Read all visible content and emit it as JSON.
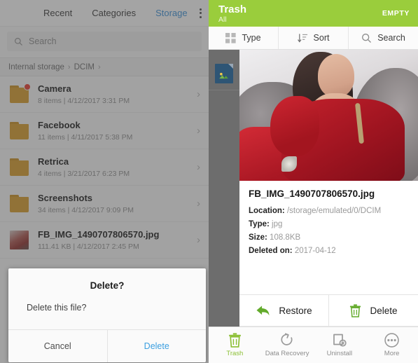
{
  "left_panel": {
    "tabs": [
      {
        "label": "Recent",
        "active": false
      },
      {
        "label": "Categories",
        "active": false
      },
      {
        "label": "Storage",
        "active": true
      }
    ],
    "overflow_icon": "more-vertical-icon",
    "search": {
      "placeholder": "Search",
      "icon": "search-icon"
    },
    "breadcrumb": {
      "root": "Internal storage",
      "folder": "DCIM"
    },
    "items": [
      {
        "name": "Camera",
        "meta": "8 items  |  4/12/2017 3:31 PM",
        "type": "folder",
        "badge": true
      },
      {
        "name": "Facebook",
        "meta": "11 items  |  4/11/2017 5:38 PM",
        "type": "folder",
        "badge": false
      },
      {
        "name": "Retrica",
        "meta": "4 items  |  3/21/2017 6:23 PM",
        "type": "folder",
        "badge": false
      },
      {
        "name": "Screenshots",
        "meta": "34 items  |  4/12/2017 9:09 PM",
        "type": "folder",
        "badge": false
      },
      {
        "name": "FB_IMG_1490707806570.jpg",
        "meta": "111.41 KB  |  4/12/2017 2:45 PM",
        "type": "image",
        "badge": false
      }
    ]
  },
  "dialog": {
    "title": "Delete?",
    "message": "Delete this file?",
    "cancel_label": "Cancel",
    "confirm_label": "Delete"
  },
  "right_panel": {
    "header": {
      "title": "Trash",
      "subtitle": "All",
      "empty_label": "EMPTY",
      "accent": "#9ACD3C"
    },
    "toolbar": [
      {
        "label": "Type",
        "icon": "grid-icon"
      },
      {
        "label": "Sort",
        "icon": "sort-icon"
      },
      {
        "label": "Search",
        "icon": "search-icon"
      }
    ],
    "file": {
      "name": "FB_IMG_1490707806570.jpg",
      "fields": [
        {
          "key": "Location:",
          "value": "/storage/emulated/0/DCIM"
        },
        {
          "key": "Type:",
          "value": "jpg"
        },
        {
          "key": "Size:",
          "value": "108.8KB"
        },
        {
          "key": "Deleted on:",
          "value": "2017-04-12"
        }
      ]
    },
    "actions": [
      {
        "label": "Restore",
        "icon": "restore-arrow-icon"
      },
      {
        "label": "Delete",
        "icon": "trash-icon"
      }
    ],
    "nav": [
      {
        "label": "Trash",
        "icon": "trash-icon",
        "active": true
      },
      {
        "label": "Data Recovery",
        "icon": "refresh-icon",
        "active": false
      },
      {
        "label": "Uninstall",
        "icon": "uninstall-icon",
        "active": false
      },
      {
        "label": "More",
        "icon": "more-horizontal-icon",
        "active": false
      }
    ]
  }
}
